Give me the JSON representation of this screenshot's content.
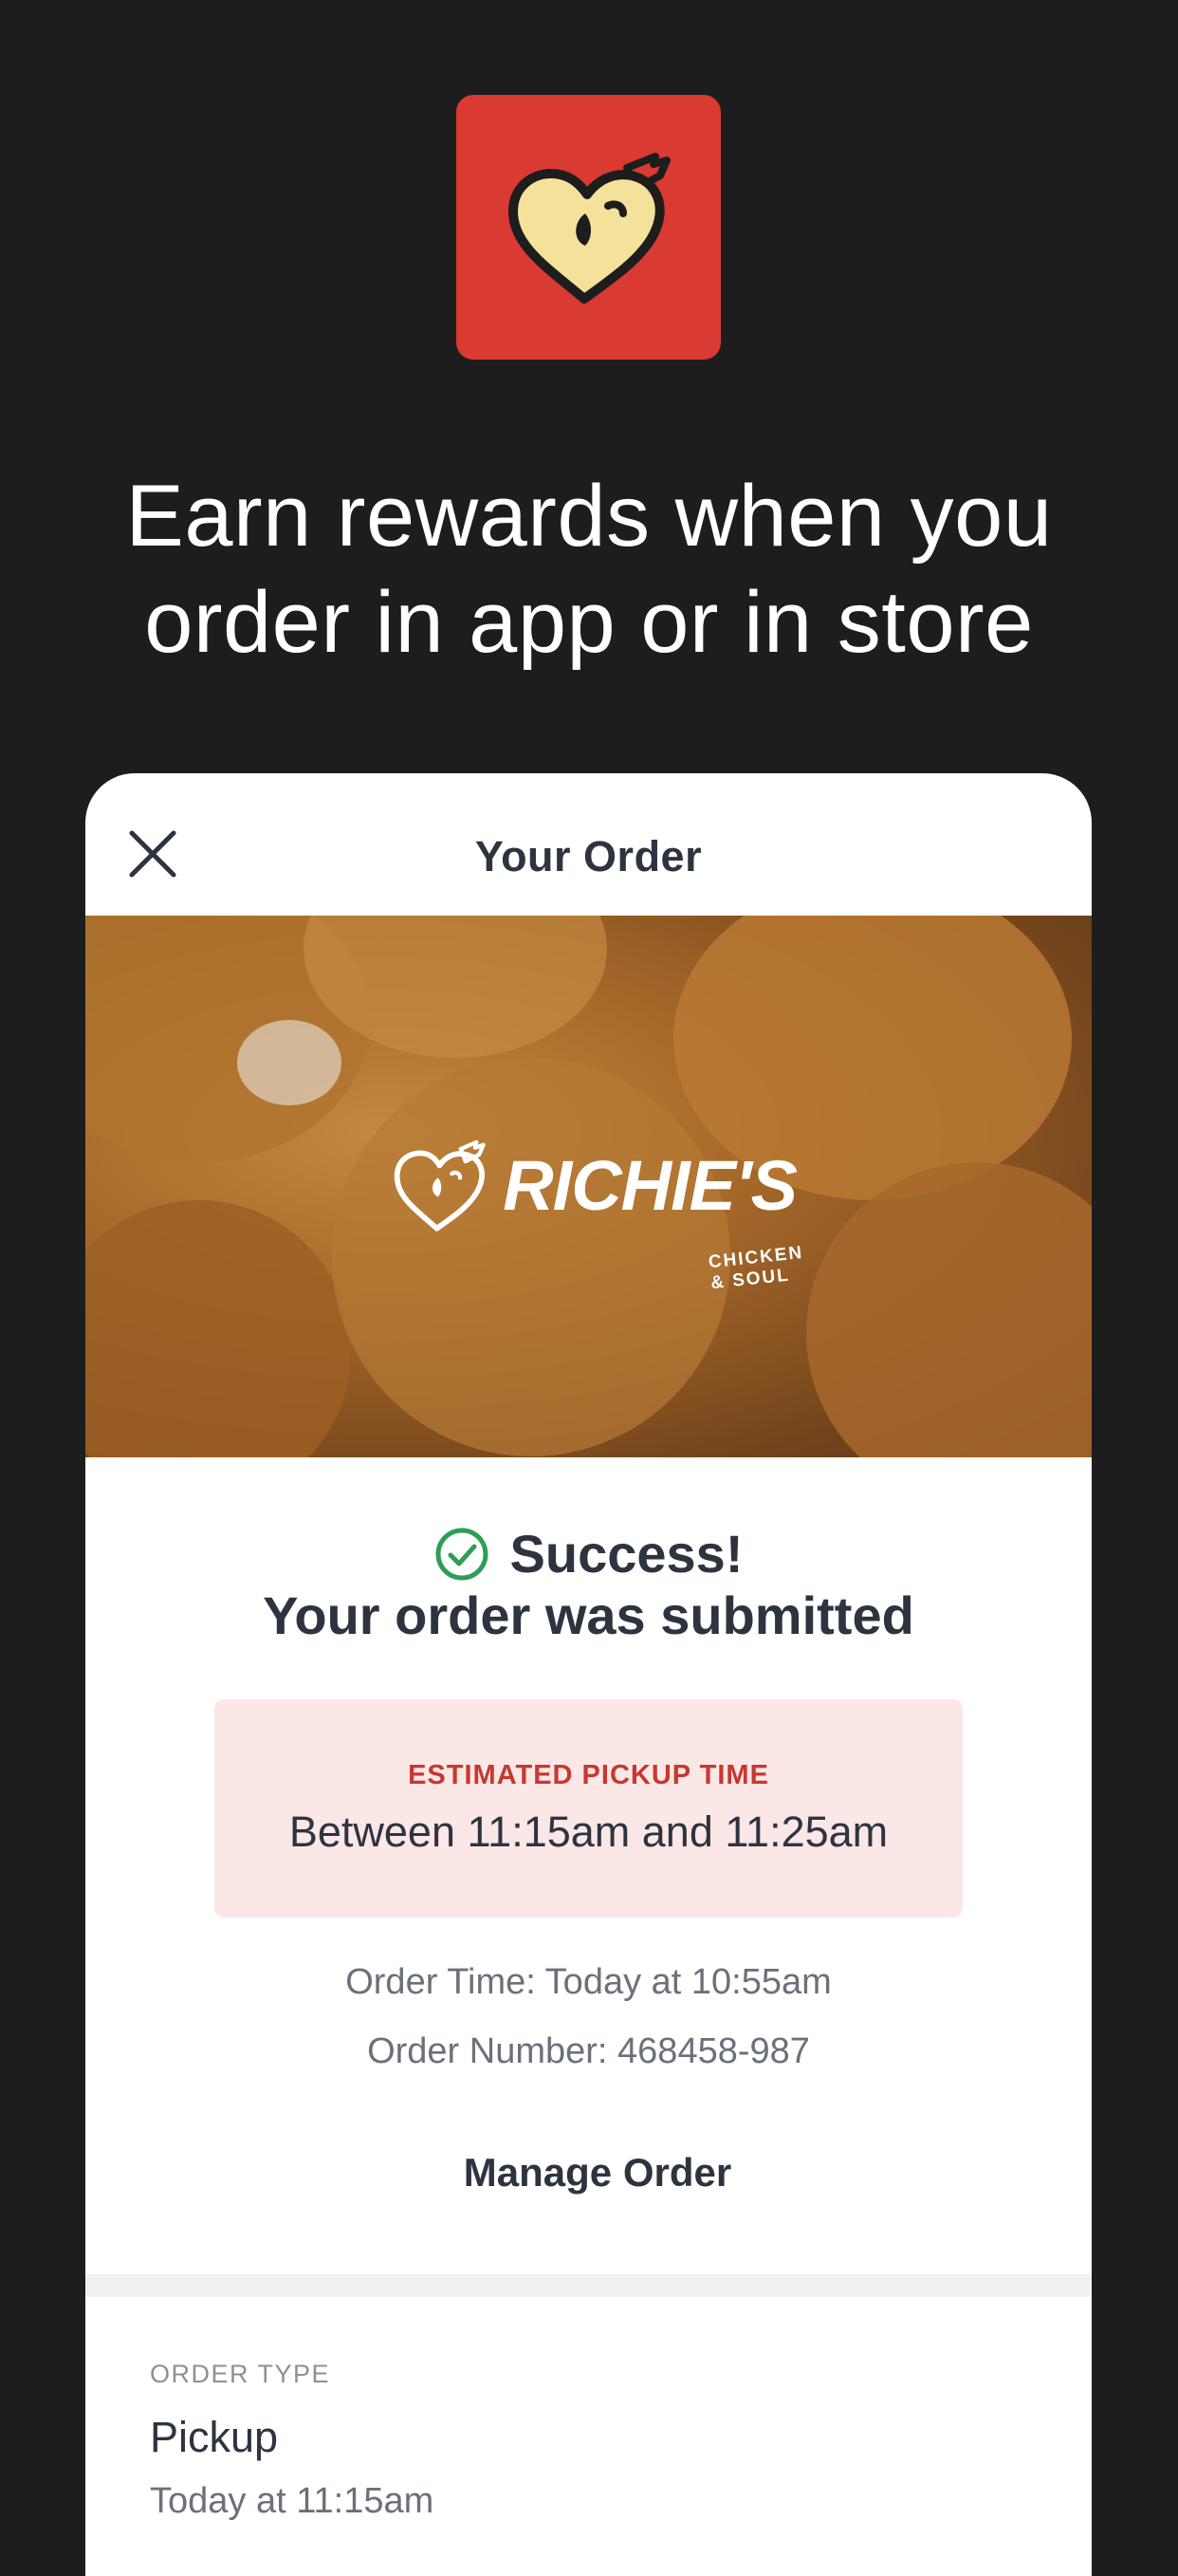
{
  "promo": {
    "headline_line1": "Earn rewards when you",
    "headline_line2": "order in app or in store"
  },
  "app_icon": {
    "name": "heart-chicken-logo-icon",
    "background": "#d93a31"
  },
  "order_card": {
    "title": "Your Order",
    "close_icon": "close-icon",
    "hero": {
      "brand_name": "RICHIE'S",
      "brand_tagline": "CHICKEN & SOUL"
    },
    "status": {
      "icon": "check-circle-icon",
      "icon_color": "#2e9e55",
      "headline": "Success!",
      "subheadline": "Your order was submitted"
    },
    "pickup": {
      "label": "ESTIMATED PICKUP TIME",
      "value": "Between 11:15am and 11:25am"
    },
    "order_time": "Order Time: Today at 10:55am",
    "order_number": "Order Number: 468458-987",
    "manage_label": "Manage Order",
    "order_type": {
      "label": "ORDER TYPE",
      "value": "Pickup",
      "time": "Today at 11:15am"
    }
  },
  "colors": {
    "background": "#1d1d1d",
    "accent_red": "#d93a31",
    "pickup_bg": "#fbe7e6",
    "text_dark": "#2d3440"
  }
}
